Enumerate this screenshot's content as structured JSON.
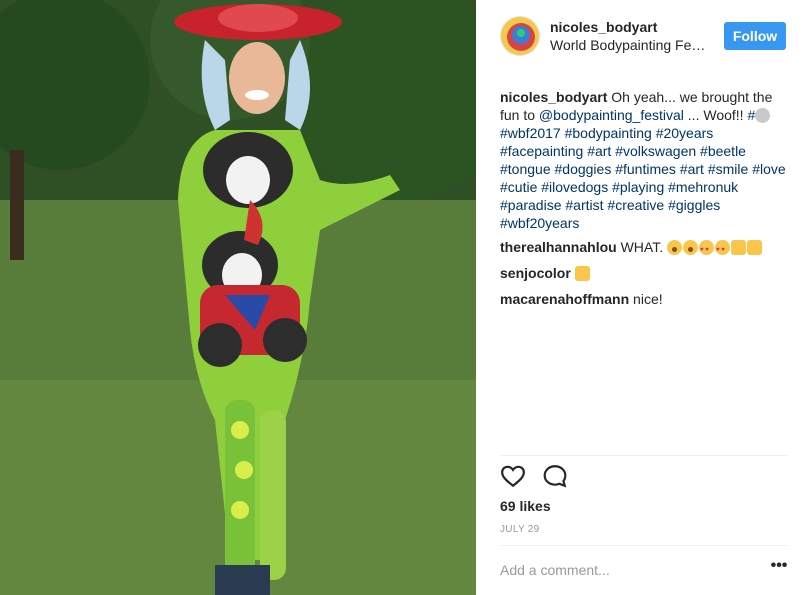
{
  "post": {
    "author": {
      "username": "nicoles_bodyart",
      "location": "World Bodypainting Festival"
    },
    "follow_label": "Follow",
    "caption": {
      "author": "nicoles_bodyart",
      "text_start": "Oh yeah... we brought the fun to",
      "mention": "@bodypainting_festival",
      "text_end": "... Woof!!",
      "hash_lead": "#",
      "hashtags": [
        "#wbf2017",
        "#bodypainting",
        "#20years",
        "#facepainting",
        "#art",
        "#volkswagen",
        "#beetle",
        "#tongue",
        "#doggies",
        "#funtimes",
        "#art",
        "#smile",
        "#love",
        "#cutie",
        "#ilovedogs",
        "#playing",
        "#mehronuk",
        "#paradise",
        "#artist",
        "#creative",
        "#giggles",
        "#wbf20years"
      ]
    },
    "comments": [
      {
        "author": "therealhannahlou",
        "text": "WHAT."
      },
      {
        "author": "senjocolor",
        "text": ""
      },
      {
        "author": "macarenahoffmann",
        "text": "nice!"
      }
    ],
    "likes": "69 likes",
    "date": "JULY 29",
    "comment_placeholder": "Add a comment...",
    "more_label": "•••",
    "icons": {
      "like": "heart-outline-icon",
      "comment": "speech-bubble-icon",
      "more": "ellipsis-icon"
    },
    "colors": {
      "follow_button": "#3897f0",
      "link": "#003569",
      "muted": "#999999"
    }
  }
}
